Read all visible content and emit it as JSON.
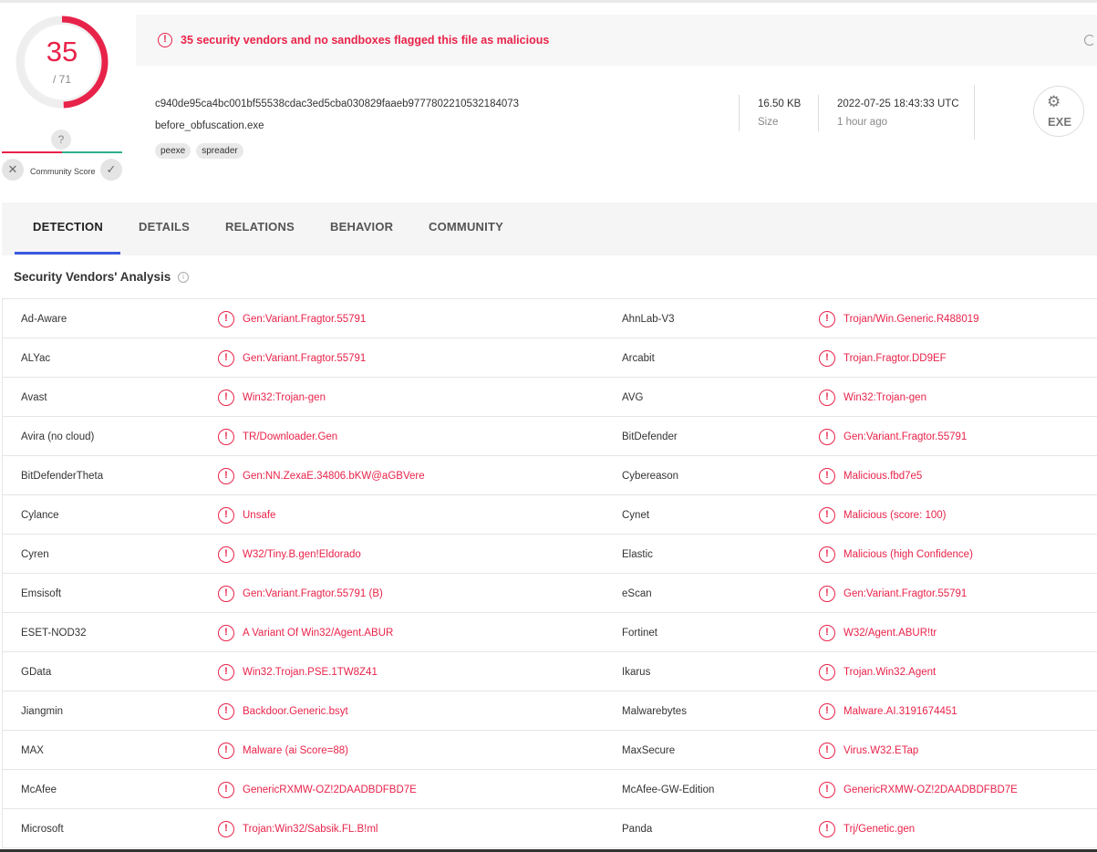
{
  "score": {
    "detected": "35",
    "total": "/ 71",
    "ratio": 0.493
  },
  "community": {
    "question": "?",
    "label": "Community Score",
    "reject": "✕",
    "accept": "✓"
  },
  "alert": {
    "icon": "!",
    "text": "35 security vendors and no sandboxes flagged this file as malicious"
  },
  "file": {
    "hash": "c940de95ca4bc001bf55538cdac3ed5cba030829faaeb9777802210532184073",
    "name": "before_obfuscation.exe",
    "tags": [
      "peexe",
      "spreader"
    ],
    "size_value": "16.50 KB",
    "size_label": "Size",
    "date_value": "2022-07-25 18:43:33 UTC",
    "date_label": "1 hour ago",
    "type_badge": "EXE"
  },
  "tabs": [
    "DETECTION",
    "DETAILS",
    "RELATIONS",
    "BEHAVIOR",
    "COMMUNITY"
  ],
  "active_tab": "DETECTION",
  "section": {
    "title": "Security Vendors' Analysis",
    "info": "i"
  },
  "colors": {
    "malicious": "#e8234a",
    "accent": "#3a59e0",
    "harmless": "#2eaf8d"
  },
  "rows": [
    {
      "v1": "Ad-Aware",
      "d1": "Gen:Variant.Fragtor.55791",
      "v2": "AhnLab-V3",
      "d2": "Trojan/Win.Generic.R488019"
    },
    {
      "v1": "ALYac",
      "d1": "Gen:Variant.Fragtor.55791",
      "v2": "Arcabit",
      "d2": "Trojan.Fragtor.DD9EF"
    },
    {
      "v1": "Avast",
      "d1": "Win32:Trojan-gen",
      "v2": "AVG",
      "d2": "Win32:Trojan-gen"
    },
    {
      "v1": "Avira (no cloud)",
      "d1": "TR/Downloader.Gen",
      "v2": "BitDefender",
      "d2": "Gen:Variant.Fragtor.55791"
    },
    {
      "v1": "BitDefenderTheta",
      "d1": "Gen:NN.ZexaE.34806.bKW@aGBVere",
      "v2": "Cybereason",
      "d2": "Malicious.fbd7e5"
    },
    {
      "v1": "Cylance",
      "d1": "Unsafe",
      "v2": "Cynet",
      "d2": "Malicious (score: 100)"
    },
    {
      "v1": "Cyren",
      "d1": "W32/Tiny.B.gen!Eldorado",
      "v2": "Elastic",
      "d2": "Malicious (high Confidence)"
    },
    {
      "v1": "Emsisoft",
      "d1": "Gen:Variant.Fragtor.55791 (B)",
      "v2": "eScan",
      "d2": "Gen:Variant.Fragtor.55791"
    },
    {
      "v1": "ESET-NOD32",
      "d1": "A Variant Of Win32/Agent.ABUR",
      "v2": "Fortinet",
      "d2": "W32/Agent.ABUR!tr"
    },
    {
      "v1": "GData",
      "d1": "Win32.Trojan.PSE.1TW8Z41",
      "v2": "Ikarus",
      "d2": "Trojan.Win32.Agent"
    },
    {
      "v1": "Jiangmin",
      "d1": "Backdoor.Generic.bsyt",
      "v2": "Malwarebytes",
      "d2": "Malware.AI.3191674451"
    },
    {
      "v1": "MAX",
      "d1": "Malware (ai Score=88)",
      "v2": "MaxSecure",
      "d2": "Virus.W32.ETap"
    },
    {
      "v1": "McAfee",
      "d1": "GenericRXMW-OZ!2DAADBDFBD7E",
      "v2": "McAfee-GW-Edition",
      "d2": "GenericRXMW-OZ!2DAADBDFBD7E"
    },
    {
      "v1": "Microsoft",
      "d1": "Trojan:Win32/Sabsik.FL.B!ml",
      "v2": "Panda",
      "d2": "Trj/Genetic.gen"
    }
  ]
}
